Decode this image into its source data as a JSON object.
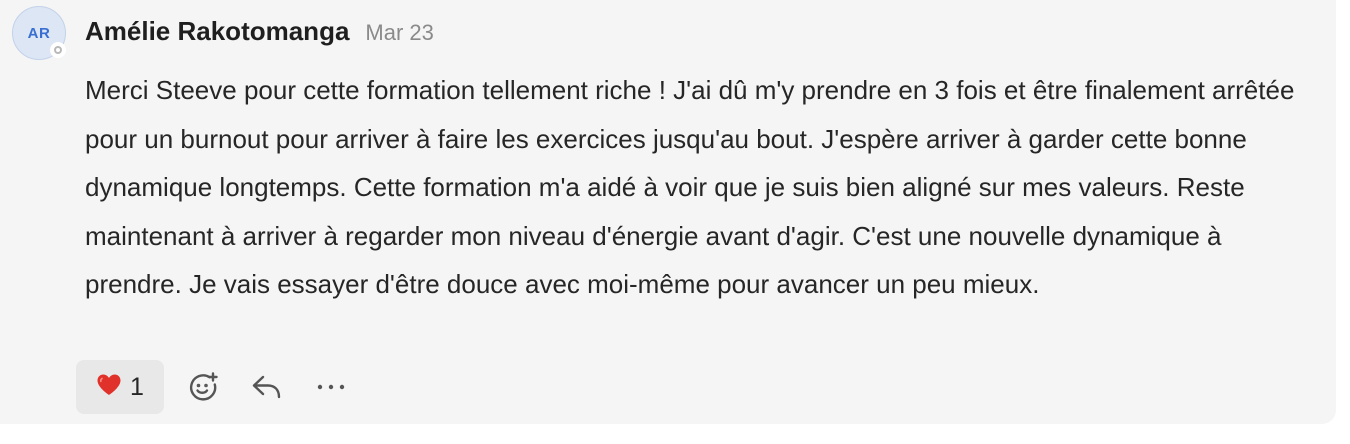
{
  "comment": {
    "avatar_initials": "AR",
    "author_name": "Amélie Rakotomanga",
    "date": "Mar 23",
    "body": "Merci Steeve pour cette formation tellement riche ! J'ai dû m'y prendre en 3 fois et être finalement arrêtée pour un burnout pour arriver à faire les exercices jusqu'au bout. J'espère arriver à garder cette bonne dynamique longtemps. Cette formation m'a aidé à voir que je suis bien aligné sur mes valeurs. Reste maintenant à arriver à regarder mon niveau d'énergie avant d'agir. C'est une nouvelle dynamique à prendre. Je vais essayer d'être douce avec moi-même pour avancer un peu mieux.",
    "presence_status": "offline"
  },
  "reactions": {
    "emoji": "❤️",
    "count": "1"
  },
  "actions": {
    "add_reaction_icon": "emoji-add-icon",
    "reply_icon": "reply-icon",
    "more_icon": "more-horizontal-icon"
  },
  "colors": {
    "card_background": "#f5f5f5",
    "avatar_background": "#dce6f5",
    "avatar_text": "#3a6fd1",
    "heart": "#e0312a"
  }
}
